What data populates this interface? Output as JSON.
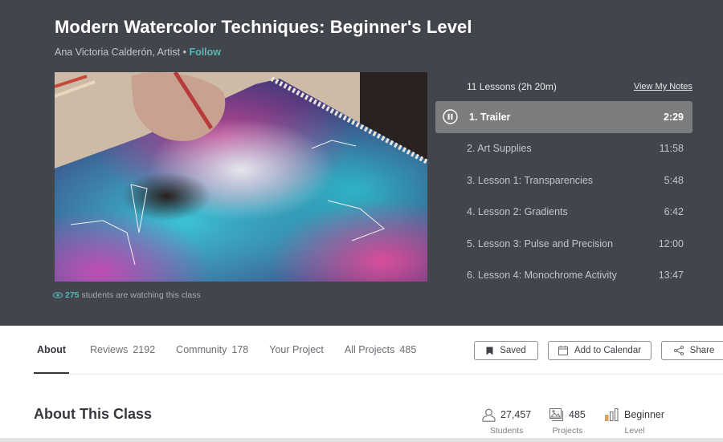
{
  "header": {
    "title": "Modern Watercolor Techniques: Beginner's Level",
    "teacher": "Ana Victoria Calderón, Artist",
    "separator": " • ",
    "follow_label": "Follow"
  },
  "video": {
    "description": "Hand painting a galaxy watercolor with constellations"
  },
  "watching": {
    "count": "275",
    "text": " students are watching this class"
  },
  "lessons": {
    "summary": "11 Lessons (2h 20m)",
    "notes_link": "View My Notes",
    "items": [
      {
        "title": "1. Trailer",
        "duration": "2:29",
        "active": true,
        "state": "playing"
      },
      {
        "title": "2. Art Supplies",
        "duration": "11:58"
      },
      {
        "title": "3. Lesson 1: Transparencies",
        "duration": "5:48"
      },
      {
        "title": "4. Lesson 2: Gradients",
        "duration": "6:42"
      },
      {
        "title": "5. Lesson 3: Pulse and Precision",
        "duration": "12:00"
      },
      {
        "title": "6. Lesson 4: Monochrome Activity",
        "duration": "13:47"
      }
    ]
  },
  "tabs": [
    {
      "label": "About",
      "count": "",
      "active": true
    },
    {
      "label": "Reviews",
      "count": "2192"
    },
    {
      "label": "Community",
      "count": "178"
    },
    {
      "label": "Your Project",
      "count": ""
    },
    {
      "label": "All Projects",
      "count": "485"
    }
  ],
  "actions": {
    "saved_label": "Saved",
    "calendar_label": "Add to Calendar",
    "share_label": "Share"
  },
  "about": {
    "title": "About This Class"
  },
  "stats": {
    "students": {
      "value": "27,457",
      "label": "Students"
    },
    "projects": {
      "value": "485",
      "label": "Projects"
    },
    "level": {
      "value": "Beginner",
      "label": "Level",
      "bars_filled": 1,
      "bars_total": 3
    }
  },
  "colors": {
    "hero_bg": "#43454c",
    "accent": "#55b8b2",
    "active_lesson_bg": "#7b7c7d",
    "level_bar": "#d9a25a"
  }
}
